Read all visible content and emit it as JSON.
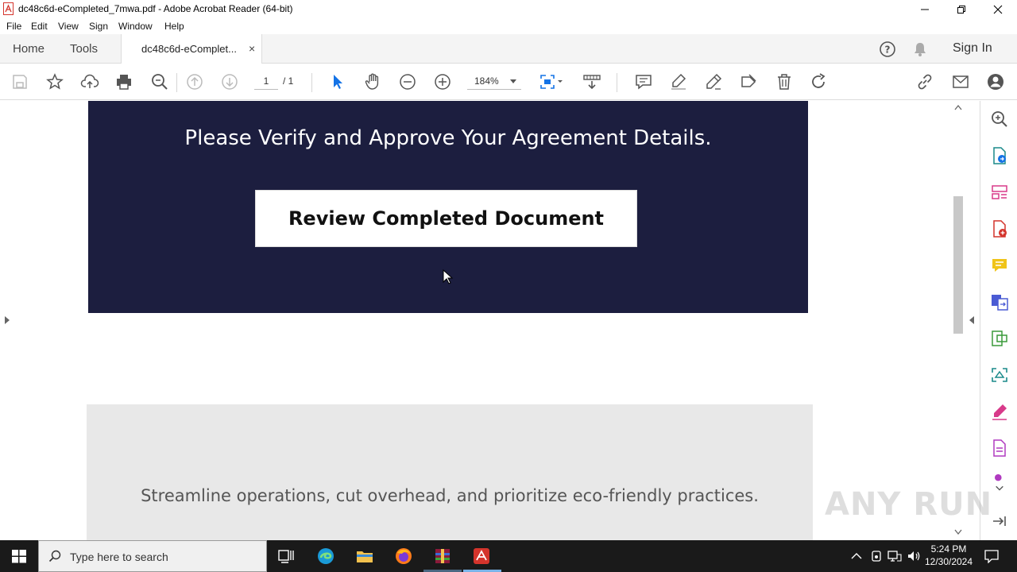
{
  "window": {
    "title": "dc48c6d-eCompleted_7mwa.pdf - Adobe Acrobat Reader (64-bit)"
  },
  "menu": [
    "File",
    "Edit",
    "View",
    "Sign",
    "Window",
    "Help"
  ],
  "tabs": {
    "home": "Home",
    "tools": "Tools",
    "document": "dc48c6d-eComplet...",
    "close": "×",
    "sign_in": "Sign In"
  },
  "toolbar": {
    "page_current": "1",
    "page_total": "/ 1",
    "zoom": "184%"
  },
  "document": {
    "heading": "Please Verify and Approve Your Agreement Details.",
    "button_label": "Review Completed Document",
    "tagline": "Streamline operations, cut overhead, and prioritize eco-friendly practices.",
    "banner_color": "#1c1e3f"
  },
  "watermark": "ANY RUN",
  "taskbar": {
    "search_placeholder": "Type here to search",
    "time": "5:24 PM",
    "date": "12/30/2024"
  },
  "colors": {
    "accent_blue": "#1473e6",
    "acrobat_red": "#d4342c",
    "taskbar": "#1a1a1a"
  }
}
